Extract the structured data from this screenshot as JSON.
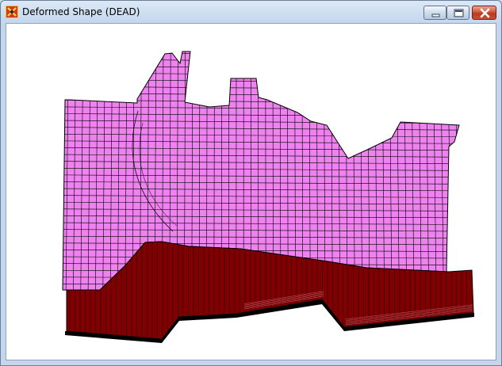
{
  "window": {
    "title": "Deformed Shape (DEAD)",
    "app_icon": "program-logo-icon"
  },
  "controls": {
    "minimize_icon": "minimize-icon",
    "maximize_icon": "maximize-icon",
    "close_icon": "close-icon"
  },
  "viewport": {
    "background": "#ffffff",
    "shell_color": "#ee82ee",
    "wall_color": "#7f0000",
    "mesh_line_color": "#000000"
  }
}
